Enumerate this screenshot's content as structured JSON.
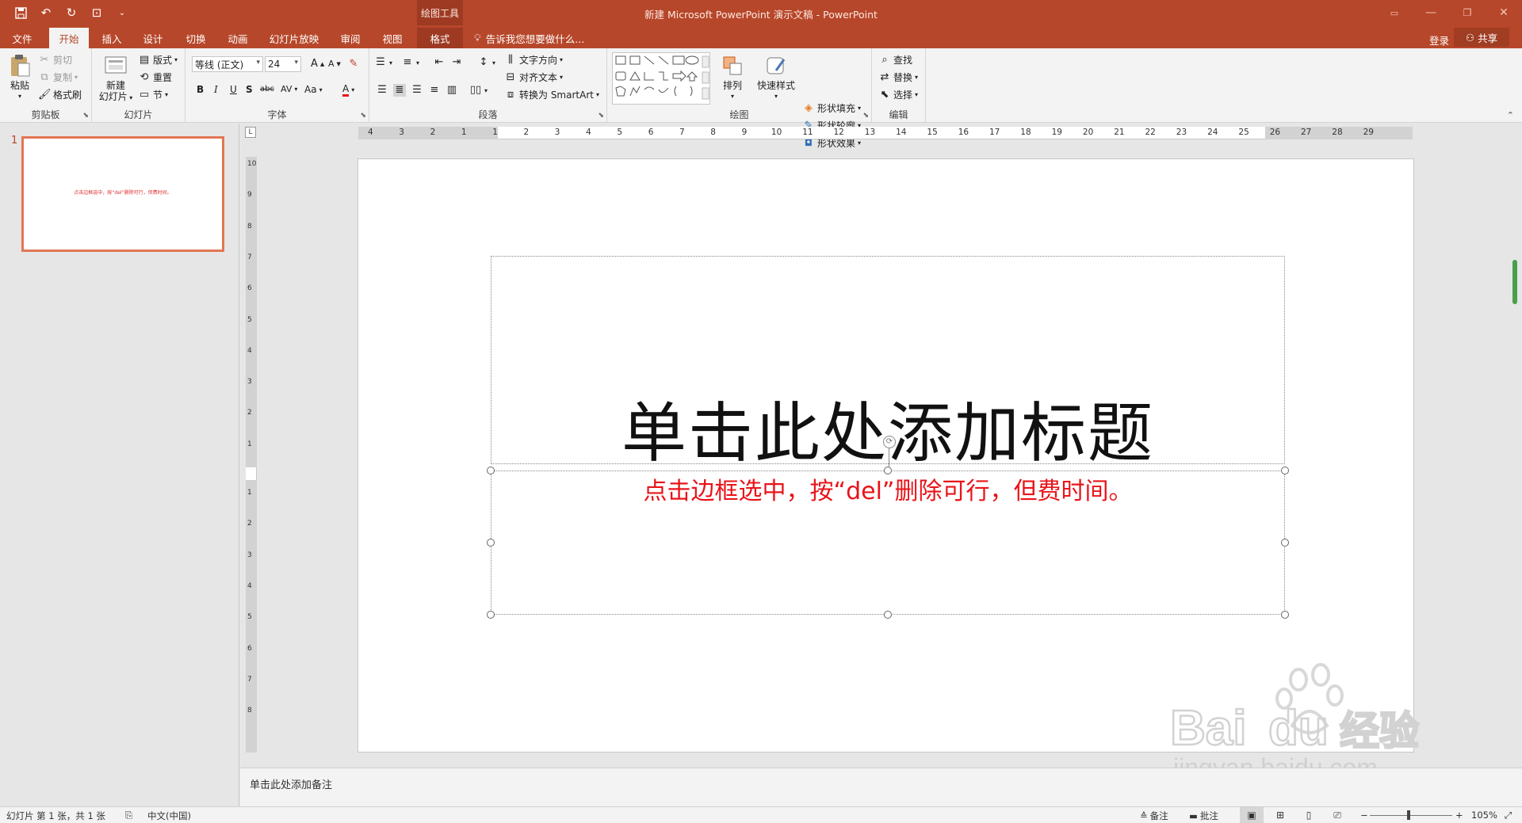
{
  "titlebar": {
    "document_title": "新建 Microsoft PowerPoint 演示文稿 - PowerPoint",
    "context_tools": "绘图工具"
  },
  "tabs": {
    "file": "文件",
    "home": "开始",
    "insert": "插入",
    "design": "设计",
    "transitions": "切换",
    "animations": "动画",
    "slideshow": "幻灯片放映",
    "review": "审阅",
    "view": "视图",
    "format": "格式",
    "tell_me": "告诉我您想要做什么...",
    "signin": "登录",
    "share": "共享"
  },
  "ribbon": {
    "clipboard": {
      "label": "剪贴板",
      "paste": "粘贴",
      "cut": "剪切",
      "copy": "复制",
      "format_painter": "格式刷"
    },
    "slides": {
      "label": "幻灯片",
      "new_slide": "新建",
      "new_slide_2": "幻灯片",
      "layout": "版式",
      "reset": "重置",
      "section": "节"
    },
    "font": {
      "label": "字体",
      "font_name": "等线 (正文)",
      "font_size": "24",
      "bold": "B",
      "italic": "I",
      "underline": "U",
      "shadow": "S",
      "strike": "abc",
      "spacing": "AV",
      "case": "Aa",
      "color": "A",
      "grow": "A",
      "shrink": "A"
    },
    "paragraph": {
      "label": "段落",
      "text_direction": "文字方向",
      "align_text": "对齐文本",
      "smartart": "转换为 SmartArt"
    },
    "drawing": {
      "label": "绘图",
      "arrange": "排列",
      "quick_styles": "快速样式",
      "shape_fill": "形状填充",
      "shape_outline": "形状轮廓",
      "shape_effects": "形状效果"
    },
    "editing": {
      "label": "编辑",
      "find": "查找",
      "replace": "替换",
      "select": "选择"
    }
  },
  "thumbnails": [
    {
      "number": "1",
      "text": "点击边框选中，按“del”删除可行，但费时间。"
    }
  ],
  "slide": {
    "title": "单击此处添加标题",
    "subtitle": "点击边框选中，按“del”删除可行，但费时间。"
  },
  "rulers": {
    "horizontal": [
      "4",
      "3",
      "2",
      "1",
      "1",
      "2",
      "3",
      "4",
      "5",
      "6",
      "7",
      "8",
      "9",
      "10",
      "11",
      "12",
      "13",
      "14",
      "15",
      "16",
      "17",
      "18",
      "19",
      "20",
      "21",
      "22",
      "23",
      "24",
      "25",
      "26",
      "27",
      "28",
      "29"
    ],
    "vertical": [
      "10",
      "9",
      "8",
      "7",
      "6",
      "5",
      "4",
      "3",
      "2",
      "1",
      "1",
      "2",
      "3",
      "4",
      "5",
      "6",
      "7",
      "8"
    ]
  },
  "notes": {
    "placeholder": "单击此处添加备注"
  },
  "statusbar": {
    "slide_info": "幻灯片 第 1 张，共 1 张",
    "language": "中文(中国)",
    "notes": "备注",
    "comments": "批注",
    "zoom": "105%"
  },
  "watermark": {
    "brand": "Bai du 经验",
    "url": "jingyan.baidu.com"
  },
  "colors": {
    "accent": "#b7472a",
    "subtitle_red": "#e8141a"
  }
}
